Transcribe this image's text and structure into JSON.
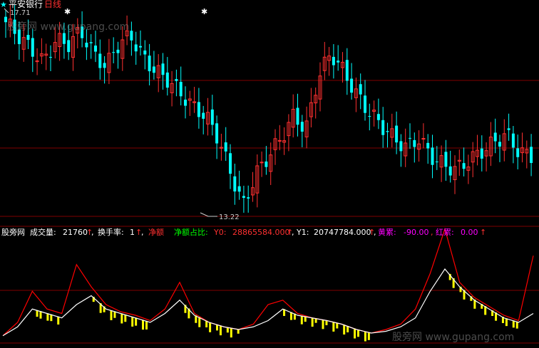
{
  "header": {
    "stock_name": "平安银行",
    "period": "日线",
    "star": "★",
    "high_marker": "17.71",
    "low_marker": "13.22"
  },
  "watermarks": {
    "top": "股旁网 www.gupang.com",
    "bottom": "股旁网 www.gupang.com"
  },
  "indicator_bar": {
    "site": "股旁网",
    "volume_label": "成交量:",
    "volume_value": "21760",
    "turnover_label": "换手率:",
    "turnover_value": "1",
    "net_label": "净额",
    "net_ratio_label": "净额占比:",
    "y0_label": "Y0:",
    "y0_value": "28865584.000",
    "y1_label": "Y1:",
    "y1_value": "20747784.000",
    "yellow_label": "黄累:",
    "yellow_value": "-90.00",
    "red_label": "红累:",
    "red_value": "0.00",
    "arrow": "↑",
    "sep": ","
  },
  "colors": {
    "background": "#000000",
    "up_candle": "#ff3030",
    "down_candle": "#00ffff",
    "grid": "#800000",
    "yellow_bar": "#ffff00",
    "red_line": "#ff0000",
    "white_line": "#ffffff"
  },
  "chart_data": [
    {
      "type": "candlestick",
      "title": "平安银行 日线",
      "price_high": 17.71,
      "price_low": 13.22,
      "approx_close_path": [
        17.5,
        17.2,
        16.9,
        16.6,
        17.1,
        17.0,
        17.3,
        16.8,
        16.5,
        17.0,
        17.2,
        16.7,
        16.4,
        16.2,
        15.9,
        15.6,
        15.4,
        14.9,
        14.1,
        13.4,
        14.1,
        14.5,
        14.9,
        15.4,
        15.1,
        16.3,
        16.8,
        16.4,
        15.9,
        15.5,
        15.2,
        14.9,
        14.7,
        14.9,
        14.5,
        14.3,
        14.2,
        14.4,
        14.6,
        14.8,
        15.0,
        14.6,
        14.5
      ]
    },
    {
      "type": "bar",
      "title": "",
      "series_names": [
        "Y0",
        "Y1",
        "黄累",
        "红累"
      ],
      "approx_white_line": [
        5,
        15,
        35,
        30,
        25,
        40,
        50,
        35,
        30,
        25,
        20,
        30,
        45,
        28,
        20,
        15,
        12,
        15,
        22,
        35,
        28,
        25,
        22,
        18,
        12,
        8,
        10,
        15,
        25,
        55,
        80,
        60,
        45,
        35,
        25,
        20,
        30
      ],
      "approx_red_line": [
        5,
        20,
        55,
        35,
        30,
        85,
        60,
        40,
        32,
        28,
        22,
        35,
        65,
        30,
        20,
        15,
        12,
        18,
        40,
        45,
        30,
        25,
        22,
        18,
        12,
        8,
        12,
        18,
        35,
        75,
        125,
        65,
        48,
        38,
        28,
        22,
        95
      ]
    }
  ]
}
